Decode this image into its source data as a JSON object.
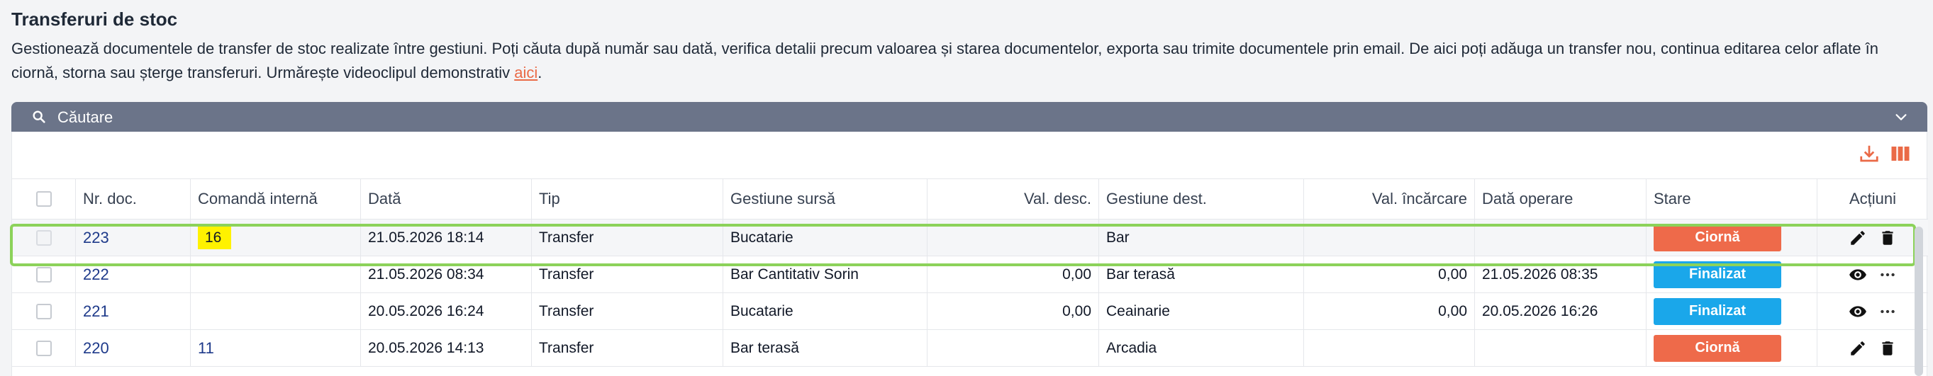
{
  "page": {
    "title": "Transferuri de stoc",
    "description_main": "Gestionează documentele de transfer de stoc realizate între gestiuni. Poți căuta după număr sau dată, verifica detalii precum valoarea și starea documentelor, exporta sau trimite documentele prin email. De aici poți adăuga un transfer nou, continua editarea celor aflate în ciornă, storna sau șterge transferuri. Urmărește videoclipul demonstrativ ",
    "description_link": "aici",
    "description_end": "."
  },
  "search": {
    "label": "Căutare",
    "icon": "search-icon"
  },
  "colors": {
    "header_bar": "#6b7489",
    "accent": "#ea6a47",
    "status_draft": "#ee6a4a",
    "status_done": "#1aa7ea",
    "link": "#1e3a8a",
    "highlight": "#fff200",
    "selection": "#8cd25a"
  },
  "toolbar": {
    "download_icon": "download-icon",
    "columns_icon": "columns-icon"
  },
  "table": {
    "columns": {
      "nr_doc": "Nr. doc.",
      "comanda": "Comandă internă",
      "data": "Dată",
      "tip": "Tip",
      "sursa": "Gestiune sursă",
      "val_desc": "Val. desc.",
      "dest": "Gestiune dest.",
      "val_inc": "Val. încărcare",
      "data_op": "Dată operare",
      "stare": "Stare",
      "actiuni": "Acțiuni"
    },
    "rows": [
      {
        "nr_doc": "223",
        "comanda": "16",
        "data": "21.05.2026 18:14",
        "tip": "Transfer",
        "sursa": "Bucatarie",
        "val_desc": "",
        "dest": "Bar",
        "val_inc": "",
        "data_op": "",
        "stare": "Ciornă",
        "actions": [
          "edit-icon",
          "trash-icon"
        ]
      },
      {
        "nr_doc": "222",
        "comanda": "",
        "data": "21.05.2026 08:34",
        "tip": "Transfer",
        "sursa": "Bar Cantitativ Sorin",
        "val_desc": "0,00",
        "dest": "Bar terasă",
        "val_inc": "0,00",
        "data_op": "21.05.2026 08:35",
        "stare": "Finalizat",
        "actions": [
          "eye-icon",
          "more-icon"
        ]
      },
      {
        "nr_doc": "221",
        "comanda": "",
        "data": "20.05.2026 16:24",
        "tip": "Transfer",
        "sursa": "Bucatarie",
        "val_desc": "0,00",
        "dest": "Ceainarie",
        "val_inc": "0,00",
        "data_op": "20.05.2026 16:26",
        "stare": "Finalizat",
        "actions": [
          "eye-icon",
          "more-icon"
        ]
      },
      {
        "nr_doc": "220",
        "comanda": "11",
        "data": "20.05.2026 14:13",
        "tip": "Transfer",
        "sursa": "Bar terasă",
        "val_desc": "",
        "dest": "Arcadia",
        "val_inc": "",
        "data_op": "",
        "stare": "Ciornă",
        "actions": [
          "edit-icon",
          "trash-icon"
        ]
      }
    ]
  }
}
